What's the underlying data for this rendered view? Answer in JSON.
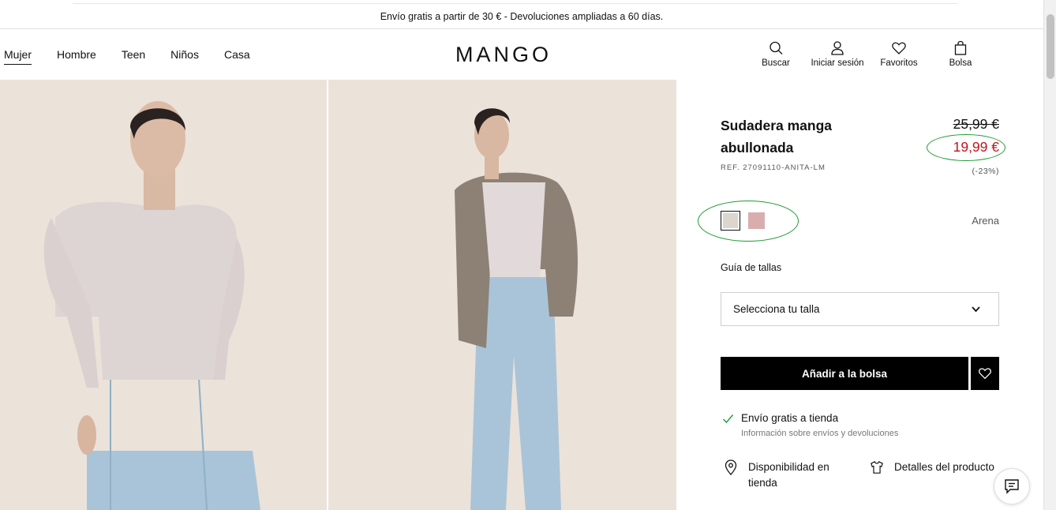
{
  "promo": {
    "text": "Envío gratis a partir de 30 € - Devoluciones ampliadas a 60 días."
  },
  "nav": {
    "items": [
      "Mujer",
      "Hombre",
      "Teen",
      "Niños",
      "Casa"
    ],
    "active": "Mujer"
  },
  "brand": {
    "logo": "MANGO"
  },
  "actions": {
    "search": "Buscar",
    "login": "Iniciar sesión",
    "favorites": "Favoritos",
    "bag": "Bolsa"
  },
  "product": {
    "title": "Sudadera manga abullonada",
    "ref": "REF. 27091110-ANITA-LM",
    "old_price": "25,99 €",
    "new_price": "19,99 €",
    "discount": "(-23%)",
    "colors": [
      "#ddd6cf",
      "#d9adae"
    ],
    "selected_color_name": "Arena",
    "size_guide": "Guía de tallas",
    "size_placeholder": "Selecciona tu talla",
    "add_to_bag": "Añadir a la bolsa",
    "shipping_title": "Envío gratis a tienda",
    "shipping_sub": "Información sobre envíos y devoluciones",
    "availability": "Disponibilidad en tienda",
    "details": "Detalles del producto"
  },
  "colors": {
    "price_red": "#c1121f",
    "annotation_green": "#1e9b32",
    "accent": "#000000"
  },
  "icons": [
    "search-icon",
    "user-icon",
    "heart-icon",
    "bag-icon",
    "chevron-down-icon",
    "check-icon",
    "location-pin-icon",
    "tshirt-icon",
    "chat-icon"
  ]
}
